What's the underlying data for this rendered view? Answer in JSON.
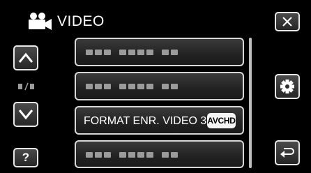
{
  "header": {
    "title": "VIDEO",
    "icon": "video-camera-icon"
  },
  "controls": {
    "close_icon": "close-icon",
    "up_icon": "chevron-up-icon",
    "down_icon": "chevron-down-icon",
    "help_label": "?",
    "settings_icon": "gear-icon",
    "back_icon": "return-icon"
  },
  "menu": {
    "items": [
      {
        "label": "",
        "state": "placeholder"
      },
      {
        "label": "",
        "state": "placeholder"
      },
      {
        "label": "FORMAT ENR. VIDEO 3D",
        "badge": "AVCHD"
      },
      {
        "label": "",
        "state": "placeholder"
      }
    ]
  },
  "colors": {
    "background": "#000000",
    "button_border": "#e8e8e8",
    "badge_bg": "#f4f4f4",
    "placeholder": "#9b9b9b"
  }
}
